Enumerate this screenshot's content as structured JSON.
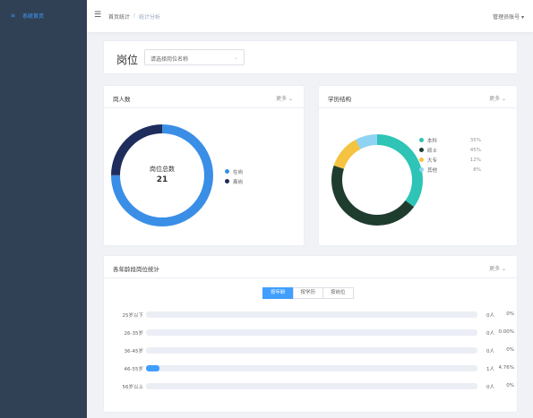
{
  "sidebar": {
    "items": [
      {
        "icon": "menu-icon",
        "glyph": "≡",
        "label": "系统首页"
      }
    ],
    "bg": "#304156",
    "accent": "#409eff"
  },
  "header": {
    "crumbs": [
      "首页统计",
      "统计分析"
    ],
    "user": "管理员账号 ▾"
  },
  "filter": {
    "label": "岗位",
    "select_value": "请选择岗位名称",
    "chevron": "⌄"
  },
  "cardA": {
    "title": "岗人数",
    "more": "更多 ⌄",
    "center_label": "岗位总数",
    "center_value": "21",
    "segments": [
      {
        "label": "在岗",
        "value": 75,
        "color": "#3a8ee6"
      },
      {
        "label": "离岗",
        "value": 25,
        "color": "#1f2d5c"
      }
    ]
  },
  "cardB": {
    "title": "学历结构",
    "more": "更多 ⌄",
    "segments": [
      {
        "label": "本科",
        "value": 35,
        "pct": "35%",
        "color": "#2ec4b6"
      },
      {
        "label": "硕士",
        "value": 45,
        "pct": "45%",
        "color": "#1f3d2f"
      },
      {
        "label": "大专",
        "value": 12,
        "pct": "12%",
        "color": "#f5c342"
      },
      {
        "label": "其他",
        "value": 8,
        "pct": "8%",
        "color": "#8fd3f4"
      }
    ]
  },
  "cardC": {
    "title": "各年龄段岗位统计",
    "more": "更多 ⌄",
    "buttons": [
      "按年龄",
      "按学历",
      "按岗位"
    ],
    "active_button": 0,
    "rows": [
      {
        "label": "25岁以下",
        "percent": 0,
        "count": "0人",
        "pct_text": "0%"
      },
      {
        "label": "26-35岁",
        "percent": 0,
        "count": "0人",
        "pct_text": "0.00%"
      },
      {
        "label": "36-45岁",
        "percent": 0,
        "count": "0人",
        "pct_text": "0%"
      },
      {
        "label": "46-55岁",
        "percent": 4,
        "count": "1人",
        "pct_text": "4.76%"
      },
      {
        "label": "56岁以上",
        "percent": 0,
        "count": "0人",
        "pct_text": "0%"
      }
    ]
  }
}
